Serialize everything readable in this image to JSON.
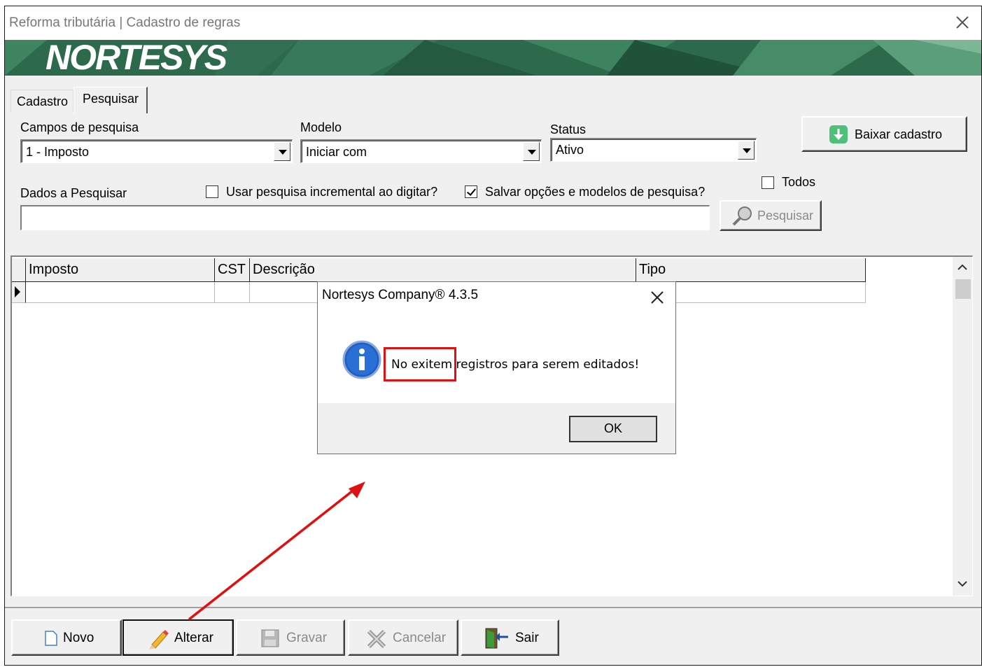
{
  "window": {
    "title": "Reforma tributária | Cadastro de regras",
    "logo_text": "NORTESYS",
    "accent_color": "#2d6b4c"
  },
  "tabs": [
    {
      "label": "Cadastro",
      "active": false
    },
    {
      "label": "Pesquisar",
      "active": true
    }
  ],
  "search": {
    "campos_label": "Campos de pesquisa",
    "campos_value": "1 - Imposto",
    "modelo_label": "Modelo",
    "modelo_value": "Iniciar com",
    "status_label": "Status",
    "status_value": "Ativo",
    "baixar_label": "Baixar cadastro",
    "todos_label": "Todos",
    "todos_checked": false,
    "dados_label": "Dados a Pesquisar",
    "dados_value": "",
    "incremental_label": "Usar pesquisa incremental ao digitar?",
    "incremental_checked": false,
    "salvar_label": "Salvar opções e modelos de pesquisa?",
    "salvar_checked": true,
    "pesquisar_label": "Pesquisar"
  },
  "grid": {
    "columns": [
      "Imposto",
      "CST",
      "Descrição",
      "Tipo"
    ],
    "rows": []
  },
  "dialog": {
    "title": "Nortesys Company® 4.3.5",
    "message": "No exitem registros para serem editados!",
    "ok_label": "OK",
    "icon": "info-icon"
  },
  "footer": {
    "novo": "Novo",
    "alterar": "Alterar",
    "gravar": "Gravar",
    "cancelar": "Cancelar",
    "sair": "Sair"
  },
  "annotation_color": "#e01010"
}
